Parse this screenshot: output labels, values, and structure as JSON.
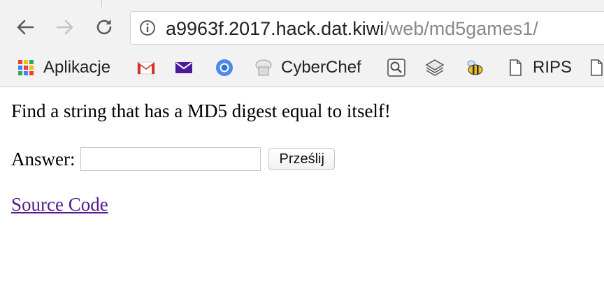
{
  "browser": {
    "url_host": "a9963f.2017.hack.dat.kiwi",
    "url_path": "/web/md5games1/",
    "bookmarks": [
      {
        "icon": "apps-grid-icon",
        "label": "Aplikacje"
      },
      {
        "icon": "gmail-icon",
        "label": ""
      },
      {
        "icon": "mail-envelope-icon",
        "label": ""
      },
      {
        "icon": "chromium-icon",
        "label": ""
      },
      {
        "icon": "chef-hat-icon",
        "label": "CyberChef"
      },
      {
        "icon": "search-box-icon",
        "label": ""
      },
      {
        "icon": "layers-icon",
        "label": ""
      },
      {
        "icon": "bee-icon",
        "label": ""
      },
      {
        "icon": "document-icon",
        "label": "RIPS"
      },
      {
        "icon": "document-icon",
        "label": ""
      }
    ]
  },
  "page": {
    "description": "Find a string that has a MD5 digest equal to itself!",
    "answer_label": "Answer:",
    "answer_value": "",
    "submit_label": "Prześlij",
    "source_link": "Source Code"
  },
  "colors": {
    "link_visited": "#551a8b",
    "chrome_bg": "#f2f2f2"
  }
}
